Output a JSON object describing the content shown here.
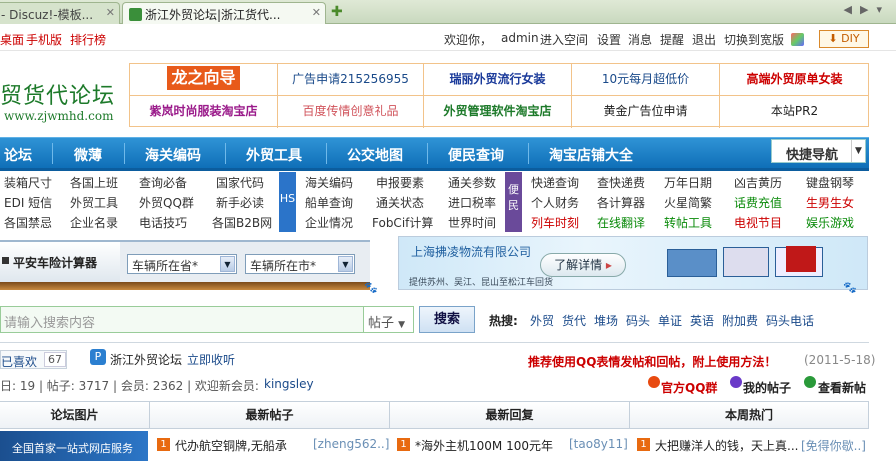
{
  "tabs": [
    {
      "label": "- Discuz!-模板..."
    },
    {
      "label": "浙江外贸论坛|浙江货代..."
    }
  ],
  "topnav": {
    "left": [
      "桌面",
      "手机版",
      "排行榜"
    ],
    "right": {
      "welcome": "欢迎你，",
      "user": "admin",
      "links": [
        "进入空间",
        "设置",
        "消息",
        "提醒",
        "退出",
        "切换到宽版"
      ],
      "diy": "DIY"
    }
  },
  "logo": {
    "name": "贸货代论坛",
    "url": "www.zjwmhd.com"
  },
  "ads": [
    "龙之向导",
    "广告申请215256955",
    "瑞丽外贸流行女装",
    "10元每月超低价",
    "高端外贸原单女装",
    "紫岚时尚服装淘宝店",
    "百度传情创意礼品",
    "外贸管理软件淘宝店",
    "黄金广告位申请",
    "本站PR2"
  ],
  "mainnav": {
    "items": [
      "论坛",
      "微薄",
      "海关编码",
      "外贸工具",
      "公交地图",
      "便民查询",
      "淘宝店铺大全"
    ],
    "quick": "快捷导航"
  },
  "links": {
    "col1": [
      [
        "装箱尺寸",
        "各国上班",
        "查询必备",
        "国家代码"
      ],
      [
        "EDI 短信",
        "外贸工具",
        "外贸QQ群",
        "新手必读"
      ],
      [
        "各国禁忌",
        "企业名录",
        "电话技巧",
        "各国B2B网"
      ]
    ],
    "hs_badge": "HS",
    "col2": [
      [
        "海关编码",
        "申报要素",
        "通关参数"
      ],
      [
        "船单查询",
        "通关状态",
        "进口税率"
      ],
      [
        "企业情况",
        "FobCif计算",
        "世界时间"
      ]
    ],
    "min_badge": "便民",
    "col3": [
      [
        "快递查询",
        "查快递费",
        "万年日期",
        "凶吉黄历",
        "键盘钢琴"
      ],
      [
        "个人财务",
        "各计算器",
        "火星简繁",
        "话费充值",
        "生男生女"
      ],
      [
        "列车时刻",
        "在线翻译",
        "转帖工具",
        "电视节目",
        "娱乐游戏"
      ]
    ]
  },
  "calc": {
    "title": "平安车险计算器",
    "province": "车辆所在省*",
    "city": "车辆所在市*"
  },
  "banner": {
    "company": "上海拂凌物流有限公司",
    "button": "了解详情",
    "slogan": "提供苏州、吴江、昆山至松江车回货"
  },
  "search": {
    "placeholder": "请输入搜索内容",
    "category": "帖子",
    "button": "搜索",
    "hot_label": "热搜:",
    "hot": [
      "外贸",
      "货代",
      "堆场",
      "码头",
      "单证",
      "英语",
      "附加费",
      "码头电话"
    ]
  },
  "stats": {
    "like_label": "已喜欢",
    "like_count": "67",
    "forum_name": "浙江外贸论坛",
    "collect": "立即收听",
    "promo": "推荐使用QQ表情发帖和回帖，附上使用方法！",
    "date": "(2011-5-18)",
    "line": "日: 19  |  帖子: 3717  |  会员: 2362  |  欢迎新会员: ",
    "new_member": "kingsley",
    "qq_group": "官方QQ群",
    "my_posts": "我的帖子",
    "view_new": "查看新帖"
  },
  "table": {
    "headers": [
      "论坛图片",
      "最新帖子",
      "最新回复",
      "本周热门"
    ],
    "thumb_caption": "全国首家一站式网店服务",
    "rows": [
      {
        "num": "1",
        "title": "代办航空铜牌,无船承",
        "author": "[zheng562..]"
      },
      {
        "num": "1",
        "title": "*海外主机100M 100元年",
        "author": "[tao8y11]"
      },
      {
        "num": "1",
        "title": "大把赚洋人的钱，天上真...",
        "author": "[免得你歇..]"
      }
    ]
  },
  "colors": {
    "accent": "#1a7ac4",
    "red": "#cc0000",
    "green": "#1d7a2a"
  }
}
